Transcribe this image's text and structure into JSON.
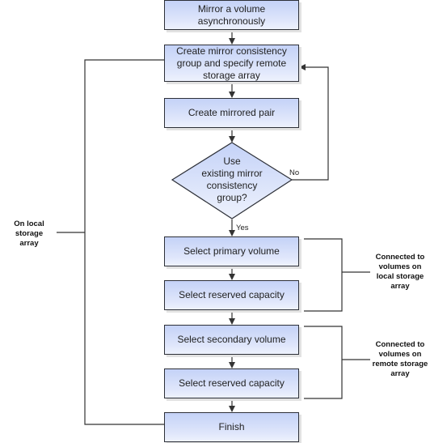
{
  "flowchart": {
    "steps": [
      {
        "id": "mirror-async",
        "label": "Mirror a volume asynchronously"
      },
      {
        "id": "create-group",
        "label": "Create mirror consistency group and specify remote storage array"
      },
      {
        "id": "create-pair",
        "label": "Create mirrored pair"
      },
      {
        "id": "decision",
        "label": "Use existing mirror consistency group?"
      },
      {
        "id": "select-primary",
        "label": "Select primary volume"
      },
      {
        "id": "select-reserved-1",
        "label": "Select reserved capacity"
      },
      {
        "id": "select-secondary",
        "label": "Select secondary volume"
      },
      {
        "id": "select-reserved-2",
        "label": "Select reserved capacity"
      },
      {
        "id": "finish",
        "label": "Finish"
      }
    ],
    "decision_lines": [
      "Use",
      "existing mirror",
      "consistency",
      "group?"
    ],
    "box1_lines": [
      "Mirror a volume",
      "asynchronously"
    ],
    "box2_lines": [
      "Create mirror consistency",
      "group and specify remote",
      "storage array"
    ],
    "branch_no": "No",
    "branch_yes": "Yes",
    "annotations": {
      "local_array": [
        "On local storage",
        "array"
      ],
      "connected_local": [
        "Connected to",
        "volumes on",
        "local storage",
        "array"
      ],
      "connected_remote": [
        "Connected to",
        "volumes on",
        "remote storage",
        "array"
      ]
    },
    "colors": {
      "box_fill_top": "#c4d2f7",
      "box_fill_bottom": "#eef2fd",
      "border": "#2d3038"
    }
  }
}
